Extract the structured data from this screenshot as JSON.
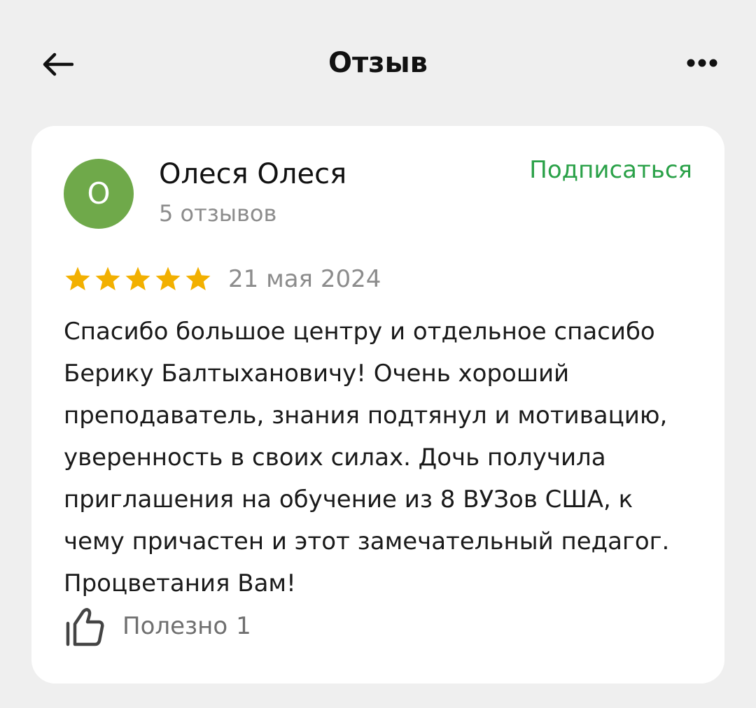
{
  "header": {
    "title": "Отзыв",
    "back_icon": "arrow-left-icon",
    "more_icon": "more-horizontal-icon"
  },
  "review": {
    "author": {
      "initial": "О",
      "name": "Олеся Олеся",
      "review_count": "5 отзывов",
      "avatar_color": "#6fa94a"
    },
    "subscribe_label": "Подписаться",
    "rating": 5,
    "rating_max": 5,
    "date": "21 мая 2024",
    "text": "Спасибо большое центру и отдельное спасибо Берику Балтыхановичу! Очень хороший преподаватель, знания подтянул и мотивацию, уверенность в своих силах. Дочь получила приглашения на обучение из 8 ВУЗов США, к чему причастен и этот замечательный педагог. Процветания Вам!",
    "helpful_label": "Полезно",
    "helpful_count": "1",
    "helpful_icon": "thumbs-up-icon"
  },
  "colors": {
    "background": "#efefef",
    "card": "#ffffff",
    "accent_green": "#2aa148",
    "star": "#f2b000",
    "muted_text": "#8c8c8c"
  }
}
